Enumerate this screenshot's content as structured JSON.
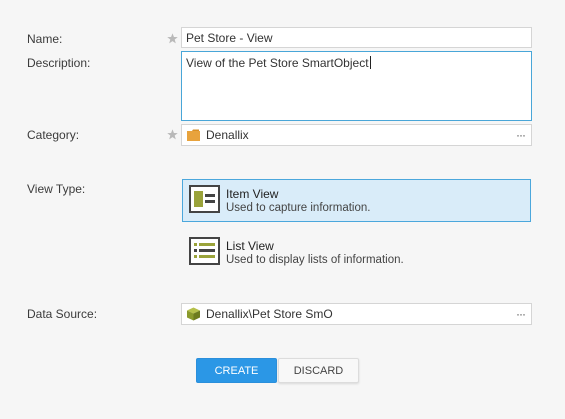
{
  "form": {
    "name_label": "Name:",
    "name_value": "Pet Store - View",
    "description_label": "Description:",
    "description_value": "View of the Pet Store SmartObject",
    "category_label": "Category:",
    "category_value": "Denallix",
    "view_type_label": "View Type:",
    "data_source_label": "Data Source:",
    "data_source_value": "Denallix\\Pet Store SmO",
    "more_glyph": "···"
  },
  "view_types": [
    {
      "title": "Item View",
      "description": "Used to capture information.",
      "selected": true,
      "icon": "item-view-icon"
    },
    {
      "title": "List View",
      "description": "Used to display lists of information.",
      "selected": false,
      "icon": "list-view-icon"
    }
  ],
  "buttons": {
    "create": "CREATE",
    "discard": "DISCARD"
  },
  "colors": {
    "accent": "#2b97e6",
    "selected_bg": "#d9ecf9",
    "selected_border": "#4ba7dc",
    "folder": "#e8a33d",
    "smartobject": "#8a9a2c"
  }
}
